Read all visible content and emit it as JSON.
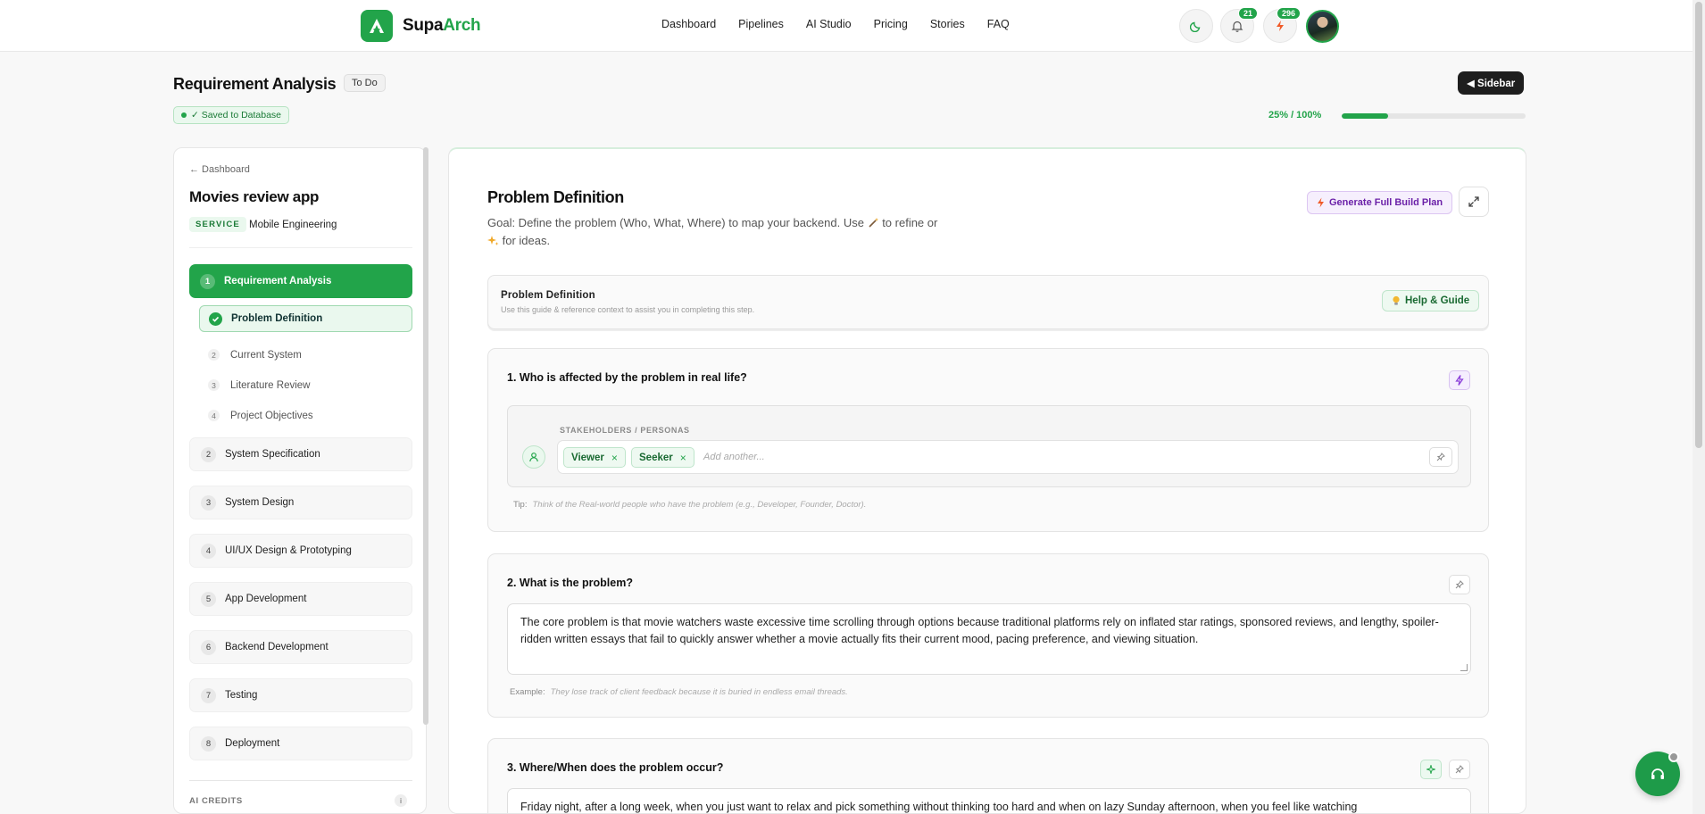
{
  "brand": {
    "name_part1": "Supa",
    "name_part2": "Arch",
    "accent": "#22a44a"
  },
  "nav": {
    "links": [
      "Dashboard",
      "Pipelines",
      "AI Studio",
      "Pricing",
      "Stories",
      "FAQ"
    ]
  },
  "header_icons": {
    "notifications_count": "21",
    "credits_count": "296",
    "theme_icon": "moon-icon",
    "bell_icon": "bell-icon",
    "bolt_icon": "bolt-icon"
  },
  "page": {
    "title": "Requirement Analysis",
    "status": "To Do",
    "saved": "✓ Saved to Database",
    "sidebar_toggle": "◀ Sidebar",
    "progress_text": "25% / 100%",
    "progress_fraction": 0.25
  },
  "sidebar": {
    "back": "← Dashboard",
    "project_title": "Movies review app",
    "service_tag": "SERVICE",
    "service_name": "Mobile Engineering",
    "active_step": {
      "num": "1",
      "label": "Requirement Analysis"
    },
    "substeps": [
      {
        "num": "",
        "label": "Problem Definition"
      },
      {
        "num": "2",
        "label": "Current System"
      },
      {
        "num": "3",
        "label": "Literature Review"
      },
      {
        "num": "4",
        "label": "Project Objectives"
      }
    ],
    "steps": [
      {
        "num": "2",
        "label": "System Specification"
      },
      {
        "num": "3",
        "label": "System Design"
      },
      {
        "num": "4",
        "label": "UI/UX Design & Prototyping"
      },
      {
        "num": "5",
        "label": "App Development"
      },
      {
        "num": "6",
        "label": "Backend Development"
      },
      {
        "num": "7",
        "label": "Testing"
      },
      {
        "num": "8",
        "label": "Deployment"
      }
    ],
    "credits_label": "AI CREDITS",
    "info": "i"
  },
  "main": {
    "title": "Problem Definition",
    "goal_part1": "Goal: Define the problem (Who, What, Where) to map your backend. Use ",
    "goal_part2": " to refine or",
    "goal_part3": " for ideas.",
    "generate_button": "Generate Full Build Plan",
    "guide": {
      "title": "Problem Definition",
      "subtitle": "Use this guide & reference context to assist you in completing this step.",
      "help_button": "Help & Guide"
    },
    "q1": {
      "title": "1. Who is affected by the problem in real life?",
      "label": "STAKEHOLDERS / PERSONAS",
      "chips": [
        "Viewer",
        "Seeker"
      ],
      "placeholder": "Add another...",
      "tip_label": "Tip:",
      "tip_text": "Think of the Real-world people who have the problem (e.g., Developer, Founder, Doctor)."
    },
    "q2": {
      "title": "2. What is the problem?",
      "answer": "The core problem is that movie watchers waste excessive time scrolling through options because traditional platforms rely on inflated star ratings, sponsored reviews, and lengthy, spoiler-ridden written essays that fail to quickly answer whether a movie actually fits their current mood, pacing preference, and viewing situation.",
      "example_label": "Example:",
      "example_text": "They lose track of client feedback because it is buried in endless email threads."
    },
    "q3": {
      "title": "3. Where/When does the problem occur?",
      "answer": "Friday night, after a long week, when you just want to relax and pick something without thinking too hard and when on lazy Sunday afternoon, when you feel like watching"
    }
  }
}
